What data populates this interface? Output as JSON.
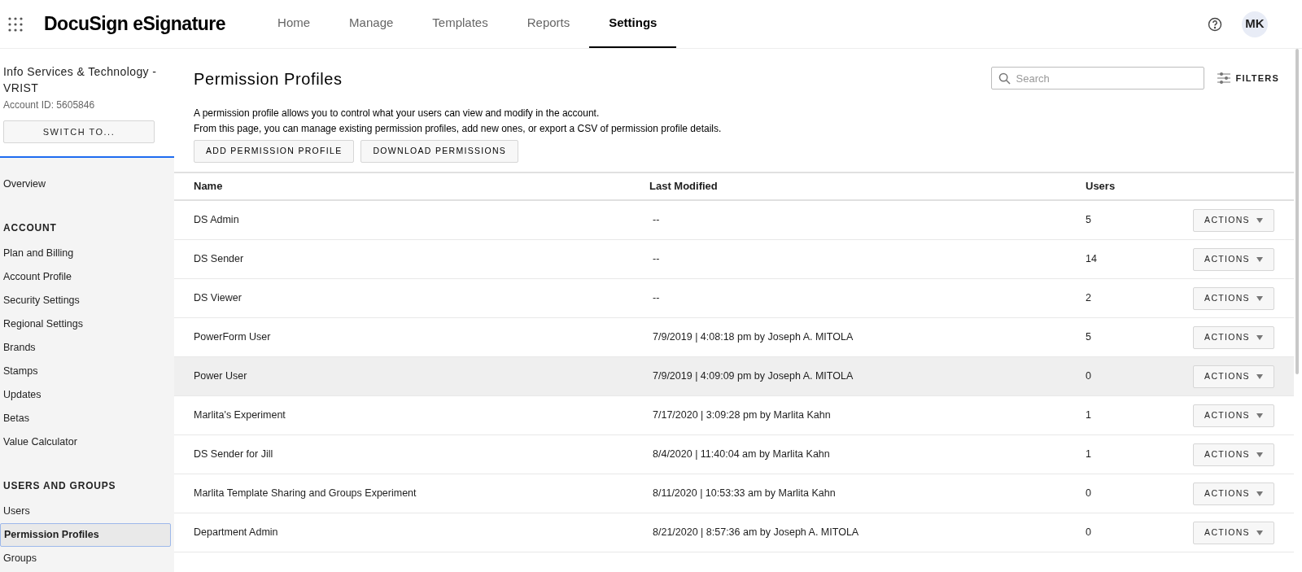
{
  "header": {
    "logo": "DocuSign eSignature",
    "tabs": [
      {
        "label": "Home",
        "selected": false
      },
      {
        "label": "Manage",
        "selected": false
      },
      {
        "label": "Templates",
        "selected": false
      },
      {
        "label": "Reports",
        "selected": false
      },
      {
        "label": "Settings",
        "selected": true
      }
    ],
    "avatar": "MK"
  },
  "sidebar": {
    "account_name": "Info Services & Technology - VRIST",
    "account_id": "Account ID: 5605846",
    "switch_button": "SWITCH TO...",
    "sections": [
      {
        "items": [
          {
            "label": "Overview",
            "selected": false
          }
        ]
      },
      {
        "heading": "ACCOUNT",
        "items": [
          {
            "label": "Plan and Billing",
            "selected": false
          },
          {
            "label": "Account Profile",
            "selected": false
          },
          {
            "label": "Security Settings",
            "selected": false
          },
          {
            "label": "Regional Settings",
            "selected": false
          },
          {
            "label": "Brands",
            "selected": false
          },
          {
            "label": "Stamps",
            "selected": false
          },
          {
            "label": "Updates",
            "selected": false
          },
          {
            "label": "Betas",
            "selected": false
          },
          {
            "label": "Value Calculator",
            "selected": false
          }
        ]
      },
      {
        "heading": "USERS AND GROUPS",
        "items": [
          {
            "label": "Users",
            "selected": false
          },
          {
            "label": "Permission Profiles",
            "selected": true
          },
          {
            "label": "Groups",
            "selected": false
          }
        ]
      }
    ]
  },
  "page": {
    "title": "Permission Profiles",
    "description": [
      "A permission profile allows you to control what your users can view and modify in the account.",
      "From this page, you can manage existing permission profiles, add new ones, or export a CSV of permission profile details."
    ],
    "buttons": [
      "ADD PERMISSION PROFILE",
      "DOWNLOAD PERMISSIONS"
    ],
    "search": {
      "placeholder": "Search"
    },
    "filters": "FILTERS"
  },
  "table": {
    "columns": [
      "Name",
      "Last Modified",
      "Users"
    ],
    "rows": [
      {
        "name": "DS Admin",
        "modified": "--",
        "users": "5",
        "action": "ACTIONS",
        "hovered": false
      },
      {
        "name": "DS Sender",
        "modified": "--",
        "users": "14",
        "action": "ACTIONS",
        "hovered": false
      },
      {
        "name": "DS Viewer",
        "modified": "--",
        "users": "2",
        "action": "ACTIONS",
        "hovered": false
      },
      {
        "name": "PowerForm User",
        "modified": "7/9/2019 | 4:08:18 pm by Joseph A. MITOLA",
        "users": "5",
        "action": "ACTIONS",
        "hovered": false
      },
      {
        "name": "Power User",
        "modified": "7/9/2019 | 4:09:09 pm by Joseph A. MITOLA",
        "users": "0",
        "action": "ACTIONS",
        "hovered": true
      },
      {
        "name": "Marlita's Experiment",
        "modified": "7/17/2020 | 3:09:28 pm by Marlita Kahn",
        "users": "1",
        "action": "ACTIONS",
        "hovered": false
      },
      {
        "name": "DS Sender for Jill",
        "modified": "8/4/2020 | 11:40:04 am by Marlita Kahn",
        "users": "1",
        "action": "ACTIONS",
        "hovered": false
      },
      {
        "name": "Marlita Template Sharing and Groups Experiment",
        "modified": "8/11/2020 | 10:53:33 am by Marlita Kahn",
        "users": "0",
        "action": "ACTIONS",
        "hovered": false
      },
      {
        "name": "Department Admin",
        "modified": "8/21/2020 | 8:57:36 am by Joseph A. MITOLA",
        "users": "0",
        "action": "ACTIONS",
        "hovered": false
      }
    ]
  }
}
